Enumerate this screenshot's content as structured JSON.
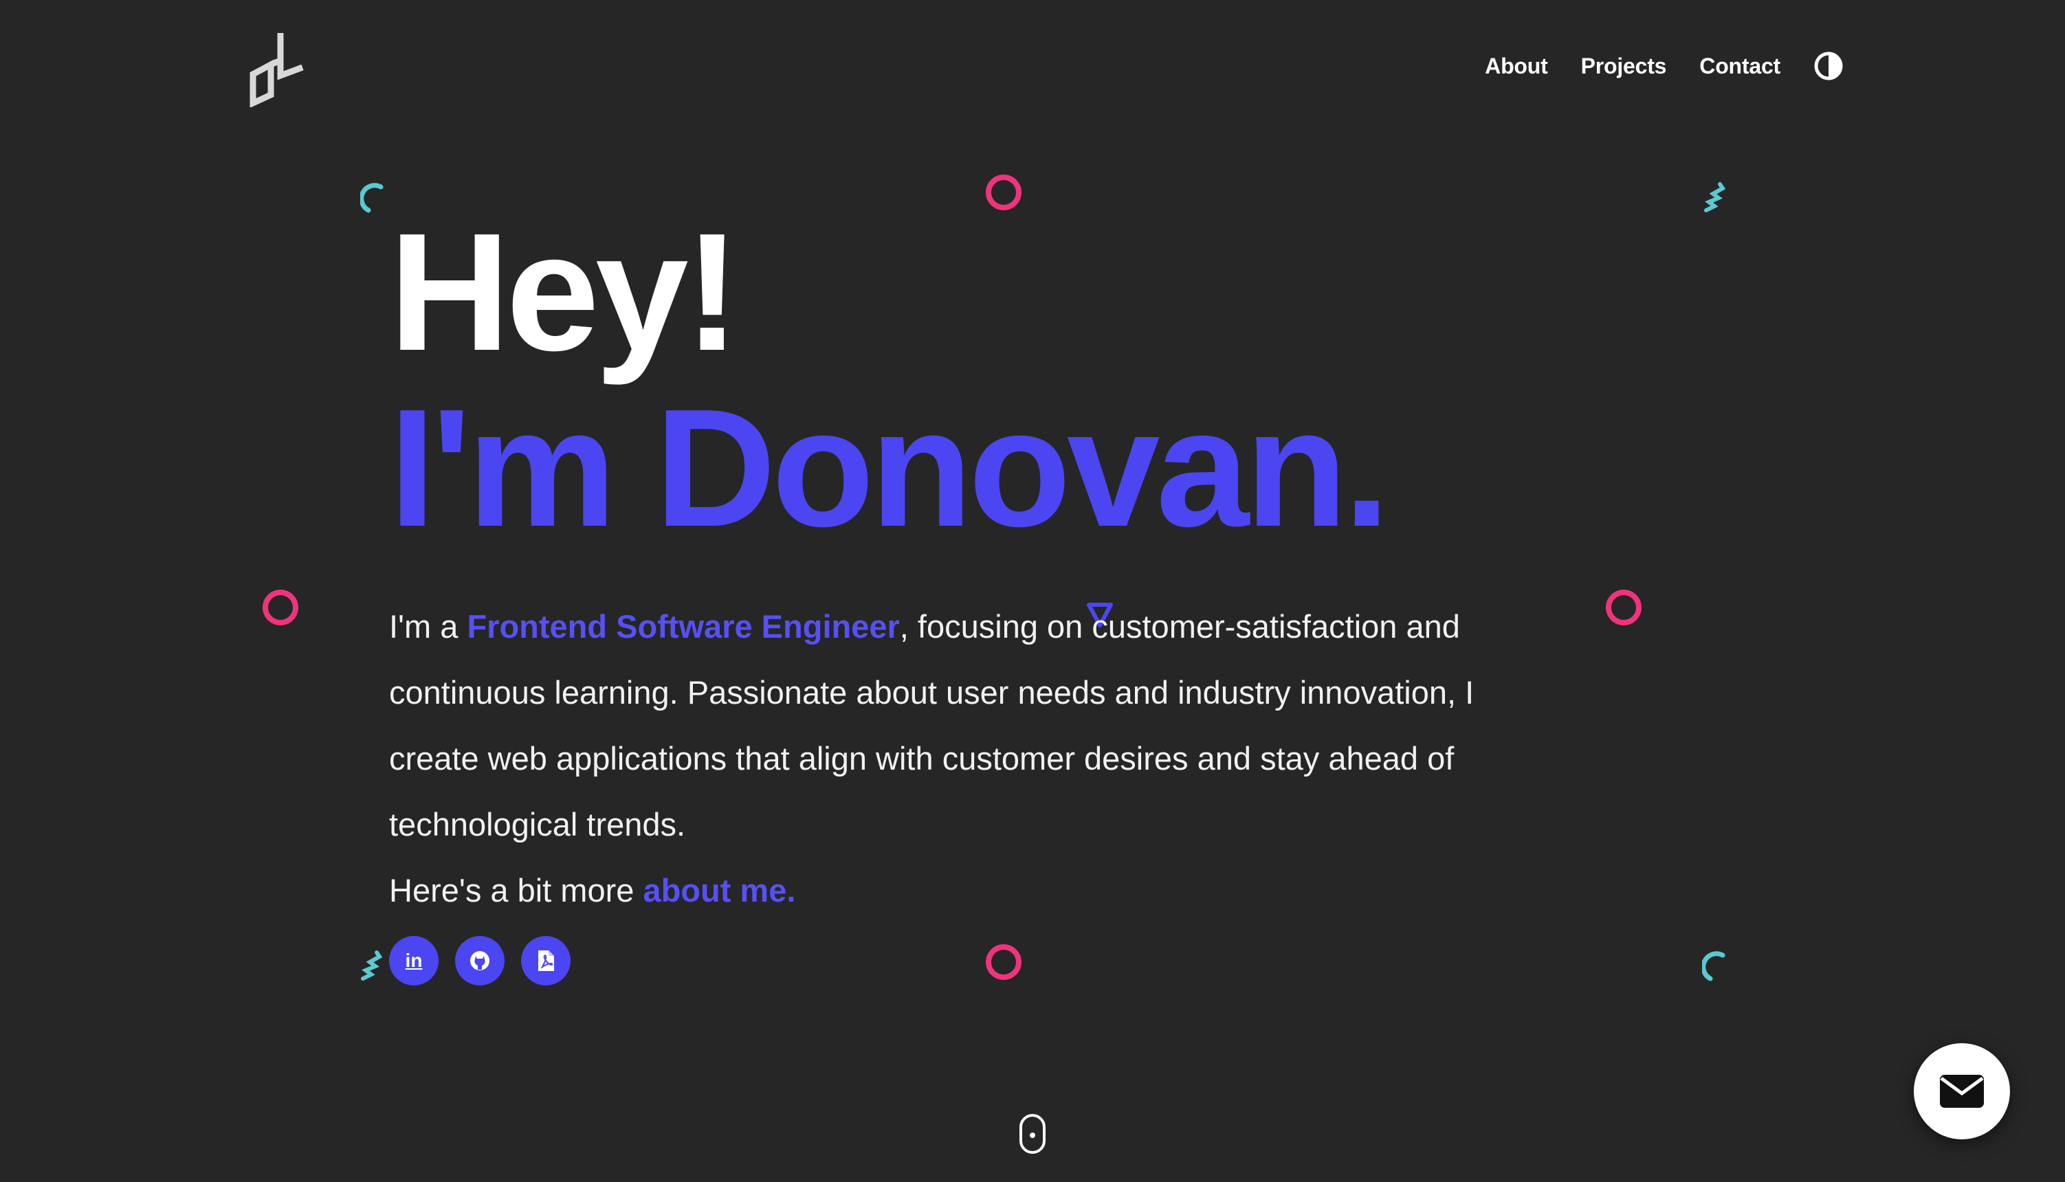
{
  "header": {
    "logo_name": "dl-monogram-logo",
    "nav": [
      {
        "label": "About"
      },
      {
        "label": "Projects"
      },
      {
        "label": "Contact"
      }
    ],
    "theme_toggle_icon": "half-circle-contrast-icon"
  },
  "hero": {
    "greeting": "Hey!",
    "name": "I'm Donovan.",
    "intro_prefix": "I'm a ",
    "intro_role": "Frontend Software Engineer",
    "intro_rest": ", focusing on customer-satisfaction and continuous learning. Passionate about user needs and industry innovation, I create web applications that align with customer desires and stay ahead of technological trends.",
    "more_prefix": "Here's a bit more ",
    "more_link": "about me."
  },
  "socials": [
    {
      "icon": "linkedin-icon",
      "glyph": "in"
    },
    {
      "icon": "github-icon"
    },
    {
      "icon": "pdf-resume-icon"
    }
  ],
  "colors": {
    "background": "#262626",
    "accent": "#4b46f2",
    "ring": "#f0337d",
    "teal": "#5bc8d3"
  },
  "fab": {
    "icon": "envelope-icon"
  },
  "scroll_indicator": {
    "icon": "mouse-scroll-icon"
  }
}
